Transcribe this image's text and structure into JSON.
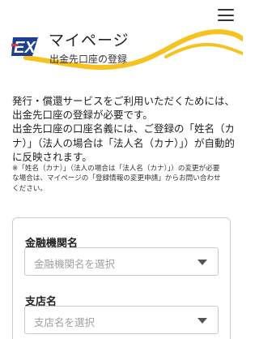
{
  "header": {
    "title": "マイページ",
    "subtitle": "出金先口座の登録",
    "logo_icon": "ex-logo-icon",
    "menu_icon": "hamburger-menu-icon",
    "accent_color": "#f5c220",
    "brand_color": "#1d3f8f",
    "brand_accent_color": "#e23b33"
  },
  "intro": {
    "lines": [
      "発行・償還サービスをご利用いただくためには、",
      "出金先口座の登録が必要です。",
      "出金先口座の口座名義には、ご登録の「姓名（カ",
      "ナ）」（法人の場合は「法人名（カナ）」）が自動的",
      "に反映されます。"
    ],
    "note_lines": [
      "※「姓名（カナ）」（法人の場合は「法人名（カナ）」）の変更が必要",
      "な場合は、マイページの「登録情報の変更申請」からお問い合わせ",
      "ください。"
    ]
  },
  "form": {
    "bank": {
      "label": "金融機関名",
      "placeholder": "金融機関名を選択"
    },
    "branch": {
      "label": "支店名",
      "placeholder": "支店名を選択"
    }
  }
}
